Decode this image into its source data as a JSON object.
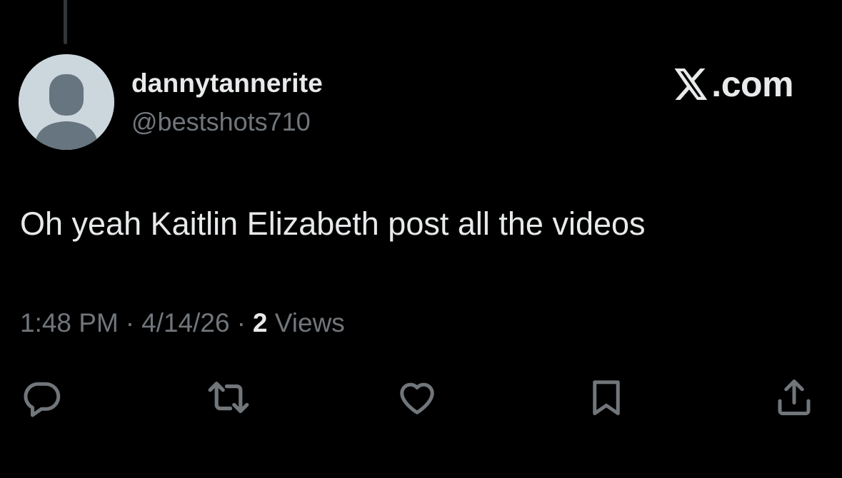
{
  "tweet": {
    "display_name": "dannytannerite",
    "handle": "@bestshots710",
    "text": "Oh yeah Kaitlin Elizabeth post all the videos",
    "time": "1:48 PM",
    "date": "4/14/26",
    "views_count": "2",
    "views_label": "Views",
    "separator": "·"
  },
  "brand": {
    "icon": "x-logo-icon",
    "text": ".com"
  },
  "actions": [
    {
      "name": "reply",
      "icon": "reply-icon"
    },
    {
      "name": "repost",
      "icon": "repost-icon"
    },
    {
      "name": "like",
      "icon": "heart-icon"
    },
    {
      "name": "bookmark",
      "icon": "bookmark-icon"
    },
    {
      "name": "share",
      "icon": "share-icon"
    }
  ],
  "colors": {
    "background": "#000000",
    "primary_text": "#e7e9ea",
    "secondary_text": "#71767b",
    "avatar_bg": "#ccd6dd",
    "avatar_fg": "#66757f"
  }
}
